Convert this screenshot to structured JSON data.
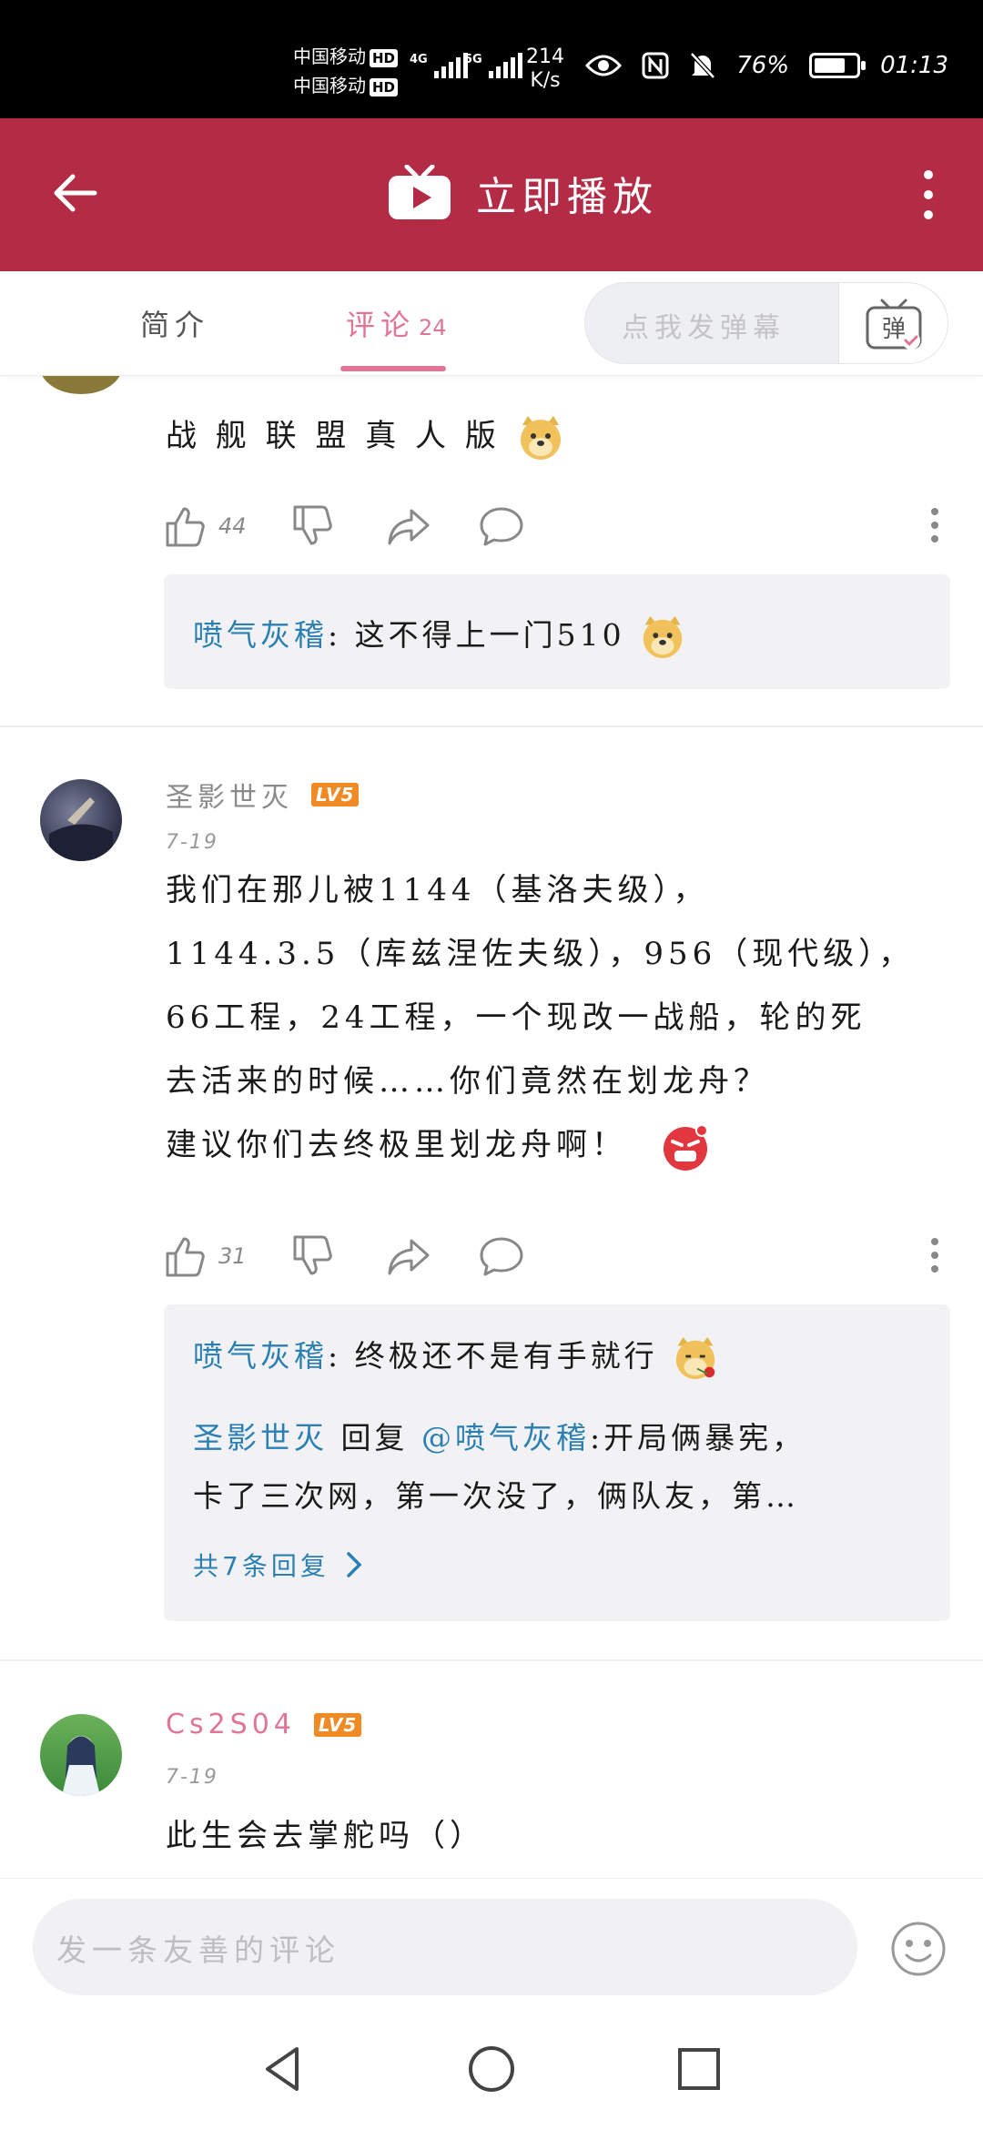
{
  "status_bar": {
    "carrier1": "中国移动",
    "carrier2": "中国移动",
    "hd": "HD",
    "net1": "4G",
    "net2": "5G",
    "speed_value": "214",
    "speed_unit": "K/s",
    "battery_percent": "76%",
    "battery_level": 0.76,
    "time": "01:13"
  },
  "header": {
    "title": "立即播放"
  },
  "tabs": {
    "intro": "简介",
    "comments": "评论",
    "comments_count": "24",
    "danmaku_placeholder": "点我发弹幕",
    "danmaku_button": "弹"
  },
  "comments": [
    {
      "text": "战 舰 联 盟 真 人 版",
      "likes": "44",
      "replies": [
        {
          "user": "喷气灰稽",
          "text": ": 这不得上一门510"
        }
      ]
    },
    {
      "user": "圣影世灭",
      "level": "LV5",
      "date": "7-19",
      "lines": [
        "我们在那儿被1144（基洛夫级），",
        "1144.3.5（库兹涅佐夫级），956（现代级），",
        "66工程，24工程，一个现改一战船，轮的死",
        "去活来的时候……你们竟然在划龙舟？",
        "建议你们去终极里划龙舟啊！"
      ],
      "likes": "31",
      "replies": [
        {
          "user": "喷气灰稽",
          "text": ": 终极还不是有手就行"
        },
        {
          "user": "圣影世灭",
          "mid": " 回复 ",
          "mention": "@喷气灰稽",
          "text": ":开局俩暴宪，",
          "text2": "卡了三次网，第一次没了，俩队友，第…"
        }
      ],
      "more_replies": "共7条回复"
    },
    {
      "user": "Cs2S04",
      "level": "LV5",
      "date": "7-19",
      "text": "此生会去掌舵吗（）"
    }
  ],
  "input": {
    "placeholder": "发一条友善的评论"
  },
  "colors": {
    "header_bg": "#b42b45",
    "accent_pink": "#e07595",
    "reply_blue": "#2a7fb3",
    "level_orange": "#f08a24"
  }
}
